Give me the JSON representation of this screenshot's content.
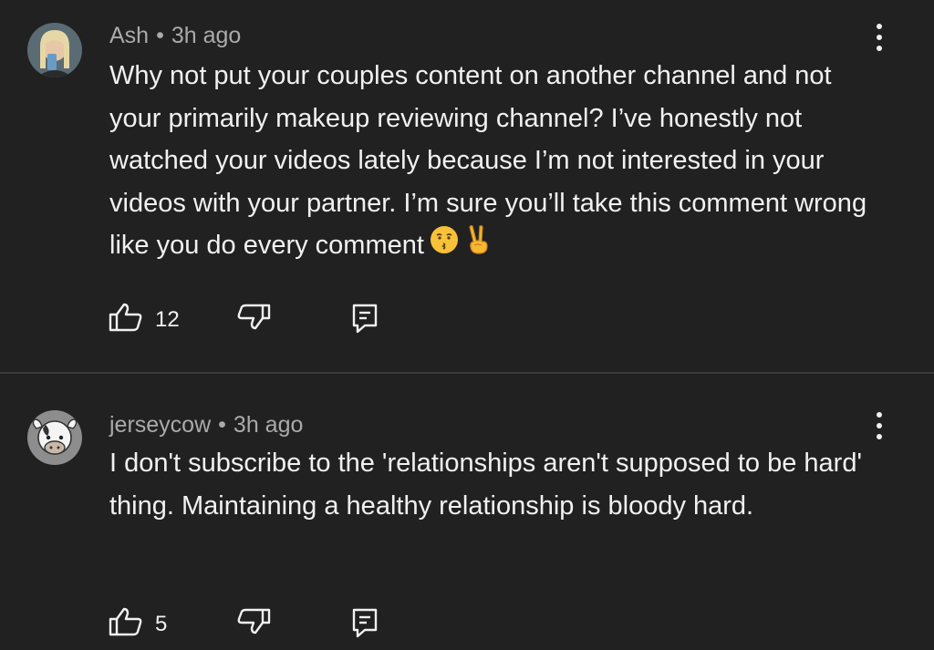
{
  "comments": [
    {
      "author": "Ash",
      "separator": "•",
      "time": "3h ago",
      "text": "Why not put your couples content on another channel and not your primarily makeup reviewing channel? I’ve honestly not watched your videos lately because I’m not interested in your videos with your partner. I’m sure you’ll take this comment wrong like you do every comment",
      "emojis": [
        "face-blowing-kiss",
        "victory-hand"
      ],
      "likes": "12"
    },
    {
      "author": "jerseycow",
      "separator": "•",
      "time": "3h ago",
      "text": "I don't subscribe to the 'relationships aren't supposed to be hard' thing. Maintaining a healthy relationship is bloody hard.",
      "likes": "5"
    }
  ],
  "icons": {
    "like": "thumbs-up-icon",
    "dislike": "thumbs-down-icon",
    "reply": "reply-icon",
    "more": "more-vertical-icon"
  },
  "colors": {
    "background": "#212121",
    "text": "#f1f1f1",
    "meta": "#aaaaaa",
    "divider": "#3a3a3a"
  }
}
